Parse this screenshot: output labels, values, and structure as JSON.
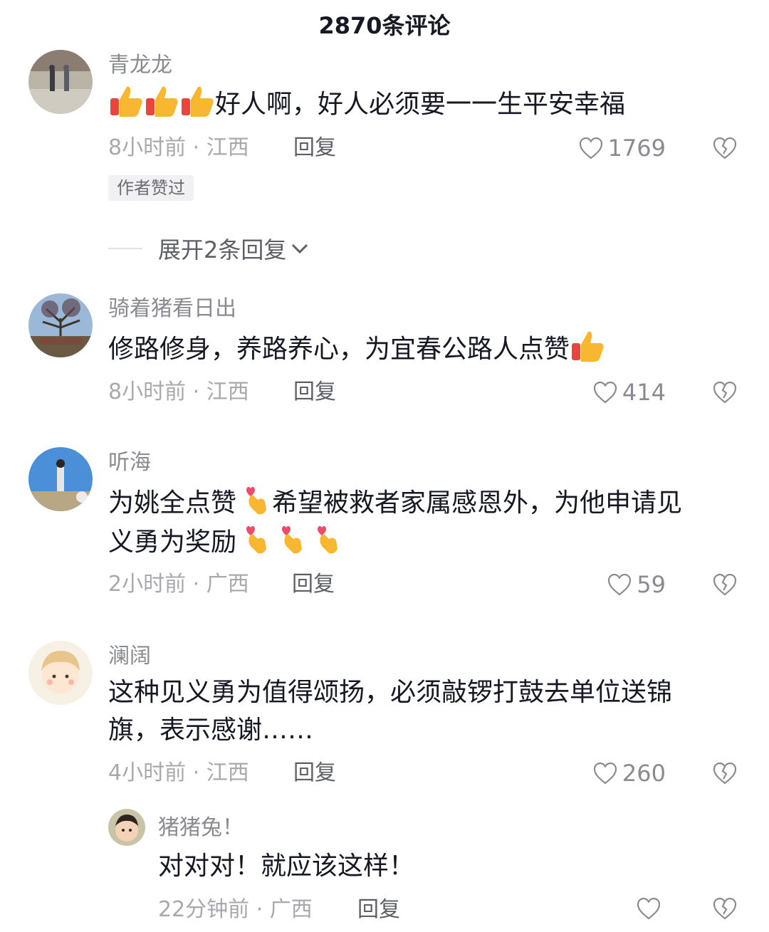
{
  "header": {
    "title": "2870条评论"
  },
  "comments": [
    {
      "username": "青龙龙",
      "text": "好人啊，好人必须要一一生平安幸福",
      "time": "8小时前 · 江西",
      "reply": "回复",
      "likes": "1769",
      "author_liked_tag": "作者赞过",
      "expand_label": "展开2条回复",
      "emojis_before": [
        "thumbs-up",
        "thumbs-up",
        "thumbs-up"
      ]
    },
    {
      "username": "骑着猪看日出",
      "text": "修路修身，养路养心，为宜春公路人点赞",
      "time": "8小时前 · 江西",
      "reply": "回复",
      "likes": "414",
      "emojis_after": [
        "thumbs-up"
      ]
    },
    {
      "username": "听海",
      "text_part1": "为姚全点赞",
      "text_part2": "希望被救者家属感恩外，为他申请见",
      "text_part3": "义勇为奖励",
      "time": "2小时前 · 广西",
      "reply": "回复",
      "likes": "59",
      "emojis": [
        "finger-heart",
        "finger-heart",
        "finger-heart",
        "finger-heart"
      ]
    },
    {
      "username": "澜阔",
      "text": "这种见义勇为值得颂扬，必须敲锣打鼓去单位送锦旗，表示感谢……",
      "time": "4小时前 · 江西",
      "reply": "回复",
      "likes": "260"
    },
    {
      "username": "猪猪兔！",
      "text": "对对对！就应该这样！",
      "time": "22分钟前 · 广西",
      "reply": "回复",
      "likes": "",
      "is_reply": true
    }
  ],
  "colors": {
    "text": "#161823",
    "secondary": "#8a8b91",
    "thumb": "#f7b731",
    "heart": "#f04c6a"
  }
}
